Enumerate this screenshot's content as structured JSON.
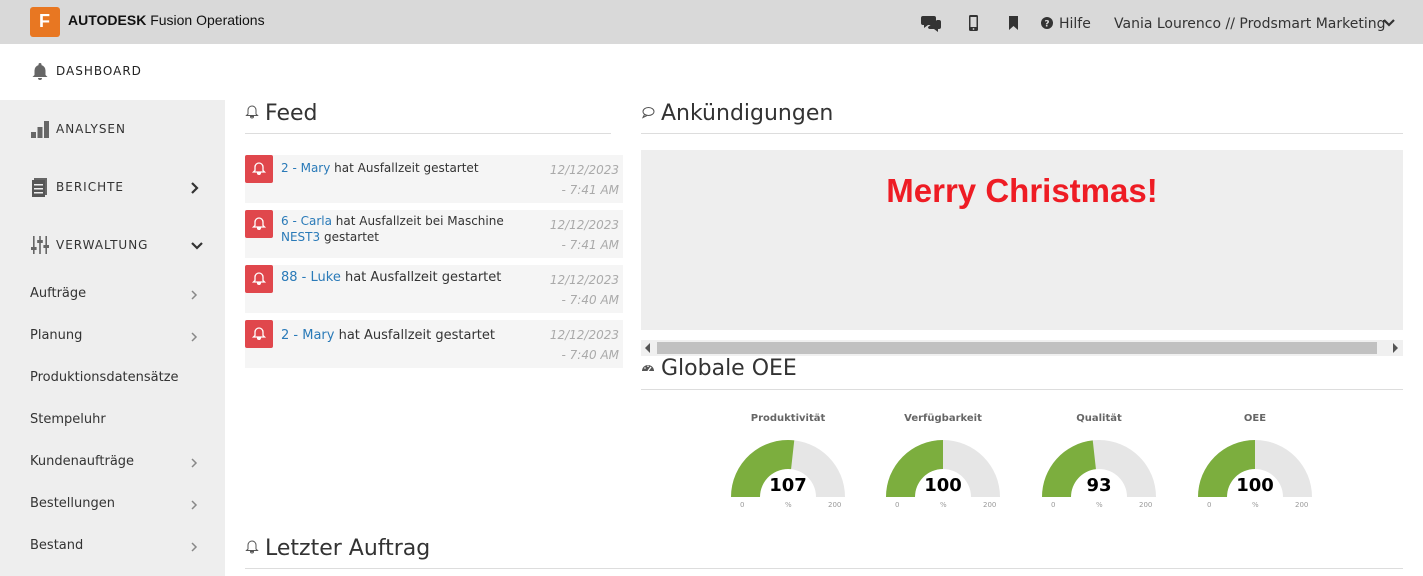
{
  "header": {
    "logo_letter": "F",
    "brand_bold": "AUTODESK",
    "brand_rest": " Fusion Operations",
    "help_label": "Hilfe",
    "user_label": "Vania Lourenco // Prodsmart Marketing",
    "icons": [
      "chat-icon",
      "mobile-icon",
      "bookmark-icon",
      "question-icon",
      "chevron-down-icon"
    ]
  },
  "sidebar": {
    "dashboard": "DASHBOARD",
    "analysen": "ANALYSEN",
    "berichte": "BERICHTE",
    "verwaltung": "VERWALTUNG",
    "items": [
      {
        "label": "Aufträge",
        "chevron": true
      },
      {
        "label": "Planung",
        "chevron": true
      },
      {
        "label": "Produktionsdatensätze",
        "chevron": false
      },
      {
        "label": "Stempeluhr",
        "chevron": false
      },
      {
        "label": "Kundenaufträge",
        "chevron": true
      },
      {
        "label": "Bestellungen",
        "chevron": true
      },
      {
        "label": "Bestand",
        "chevron": true
      }
    ]
  },
  "feed": {
    "title": "Feed",
    "items": [
      {
        "who": "2 - Mary",
        "text": " hat Ausfallzeit gestartet",
        "machine": "",
        "text2": "",
        "date": "12/12/2023",
        "time": "- 7:41 AM"
      },
      {
        "who": "6 - Carla",
        "text": " hat Ausfallzeit bei Maschine ",
        "machine": "NEST3",
        "text2": " gestartet",
        "date": "12/12/2023",
        "time": "- 7:41 AM"
      },
      {
        "who": "88 - Luke",
        "text": " hat Ausfallzeit gestartet",
        "machine": "",
        "text2": "",
        "date": "12/12/2023",
        "time": "- 7:40 AM"
      },
      {
        "who": "2 - Mary",
        "text": " hat Ausfallzeit gestartet",
        "machine": "",
        "text2": "",
        "date": "12/12/2023",
        "time": "- 7:40 AM"
      }
    ]
  },
  "announcements": {
    "title": "Ankündigungen",
    "message": "Merry Christmas!",
    "message_color": "#ee1c24"
  },
  "oee": {
    "title": "Globale OEE",
    "gauges": [
      {
        "label": "Produktivität",
        "value": 107,
        "min": "0",
        "max": "200",
        "unit": "%"
      },
      {
        "label": "Verfügbarkeit",
        "value": 100,
        "min": "0",
        "max": "200",
        "unit": "%"
      },
      {
        "label": "Qualität",
        "value": 93,
        "min": "0",
        "max": "200",
        "unit": "%"
      },
      {
        "label": "OEE",
        "value": 100,
        "min": "0",
        "max": "200",
        "unit": "%"
      }
    ],
    "fill_color": "#7cae3e",
    "track_color": "#e6e6e6"
  },
  "last_order": {
    "title": "Letzter Auftrag"
  }
}
